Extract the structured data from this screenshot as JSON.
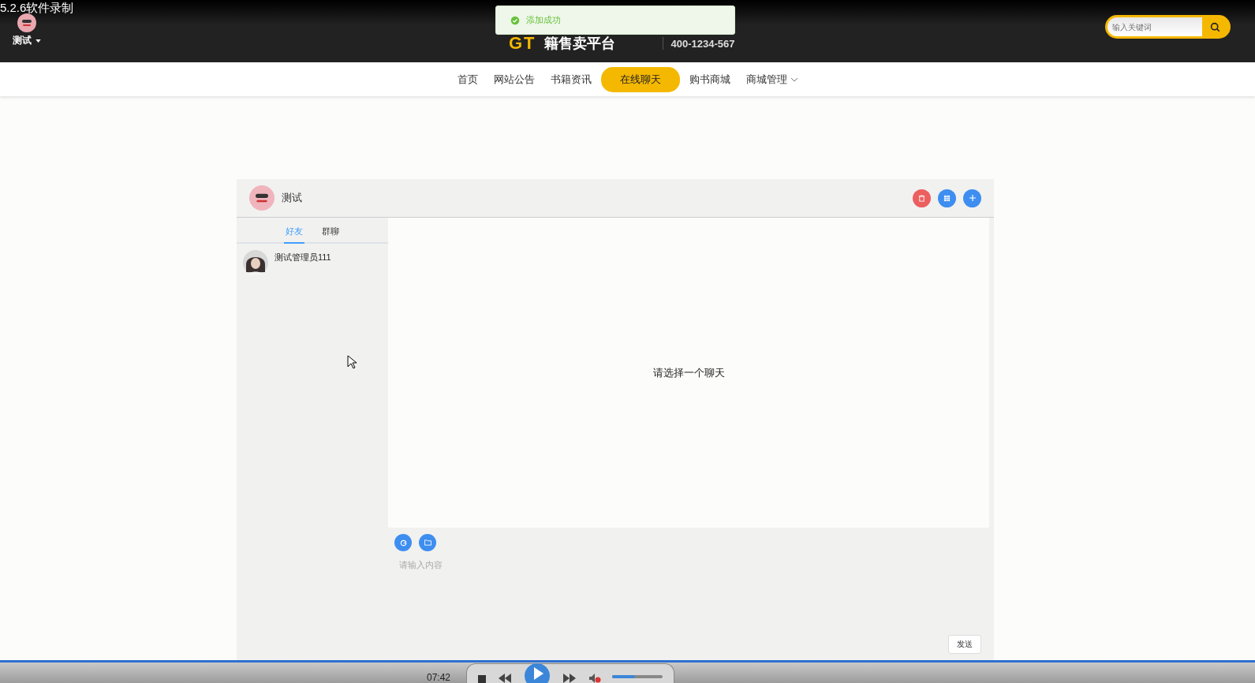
{
  "recorder_label": "5.2.6软件录制",
  "user_menu": {
    "name": "测试"
  },
  "toast": {
    "text": "添加成功"
  },
  "logo": {
    "mark": "GT",
    "name": "籍售卖平台"
  },
  "phone": "400-1234-567",
  "search": {
    "placeholder": "输入关键词"
  },
  "nav": [
    {
      "label": "首页",
      "selected": false,
      "dropdown": false
    },
    {
      "label": "网站公告",
      "selected": false,
      "dropdown": false
    },
    {
      "label": "书籍资讯",
      "selected": false,
      "dropdown": false
    },
    {
      "label": "在线聊天",
      "selected": true,
      "dropdown": false
    },
    {
      "label": "购书商城",
      "selected": false,
      "dropdown": false
    },
    {
      "label": "商城管理",
      "selected": false,
      "dropdown": true
    }
  ],
  "chat": {
    "user": "测试",
    "tabs": [
      {
        "label": "好友",
        "selected": true
      },
      {
        "label": "群聊",
        "selected": false
      }
    ],
    "contacts": [
      {
        "name": "测试管理员111"
      }
    ],
    "empty_text": "请选择一个聊天",
    "input": {
      "placeholder": "请输入内容"
    },
    "send": "发送"
  },
  "player": {
    "time": "07:42",
    "volume": {
      "level": 0.45
    }
  }
}
